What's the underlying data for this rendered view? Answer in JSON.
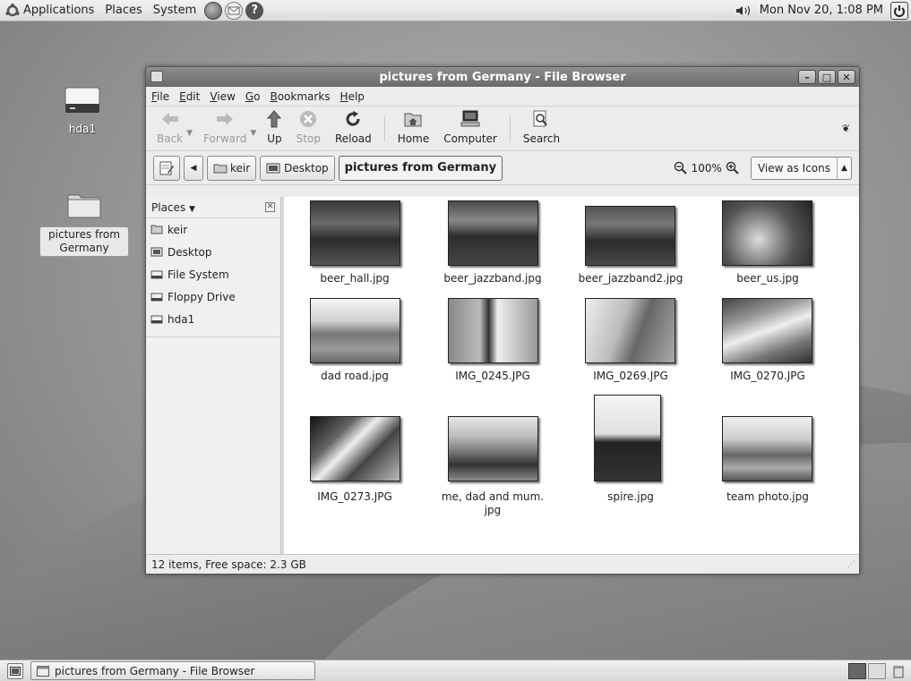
{
  "top_panel": {
    "menus": [
      "Applications",
      "Places",
      "System"
    ],
    "clock": "Mon Nov 20,  1:08 PM"
  },
  "desktop": {
    "icons": [
      {
        "label": "hda1"
      },
      {
        "label": "pictures from Germany"
      }
    ]
  },
  "window": {
    "title": "pictures from Germany - File Browser",
    "menubar": [
      "File",
      "Edit",
      "View",
      "Go",
      "Bookmarks",
      "Help"
    ],
    "toolbar": {
      "back": "Back",
      "forward": "Forward",
      "up": "Up",
      "stop": "Stop",
      "reload": "Reload",
      "home": "Home",
      "computer": "Computer",
      "search": "Search"
    },
    "location": {
      "crumbs": [
        "keir",
        "Desktop",
        "pictures from Germany"
      ],
      "zoom": "100%",
      "view_mode": "View as Icons"
    },
    "sidebar": {
      "header": "Places",
      "items": [
        "keir",
        "Desktop",
        "File System",
        "Floppy Drive",
        "hda1"
      ]
    },
    "files": [
      {
        "name": "beer_hall.jpg"
      },
      {
        "name": "beer_jazzband.jpg"
      },
      {
        "name": "beer_jazzband2.jpg"
      },
      {
        "name": "beer_us.jpg"
      },
      {
        "name": "dad road.jpg"
      },
      {
        "name": "IMG_0245.JPG"
      },
      {
        "name": "IMG_0269.JPG"
      },
      {
        "name": "IMG_0270.JPG"
      },
      {
        "name": "IMG_0273.JPG"
      },
      {
        "name": "me, dad and mum.",
        "name2": "jpg"
      },
      {
        "name": "spire.jpg"
      },
      {
        "name": "team photo.jpg"
      }
    ],
    "status": "12 items, Free space: 2.3 GB"
  },
  "bottom_panel": {
    "task": "pictures from Germany - File Browser"
  }
}
